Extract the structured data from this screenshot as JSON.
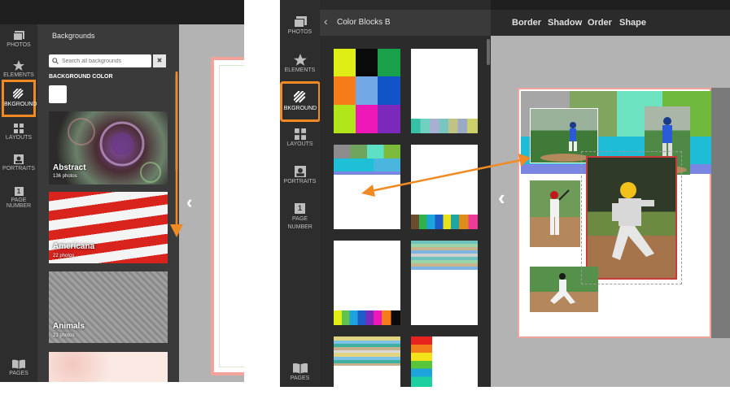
{
  "left": {
    "nav": [
      {
        "key": "photos",
        "label": "PHOTOS",
        "icon": "photos-icon"
      },
      {
        "key": "elements",
        "label": "ELEMENTS",
        "icon": "star-icon"
      },
      {
        "key": "bkground",
        "label": "BKGROUND",
        "icon": "background-stripes-icon"
      },
      {
        "key": "layouts",
        "label": "LAYOUTS",
        "icon": "layouts-icon"
      },
      {
        "key": "portraits",
        "label": "PORTRAITS",
        "icon": "portrait-icon"
      },
      {
        "key": "page_number",
        "label": "PAGE NUMBER",
        "icon": "page-number-icon",
        "glyph": "1"
      },
      {
        "key": "pages",
        "label": "PAGES",
        "icon": "book-icon"
      }
    ],
    "panel_title": "Backgrounds",
    "search_placeholder": "Search all backgrounds",
    "clear_glyph": "✖",
    "bg_color_label": "BACKGROUND COLOR",
    "categories": [
      {
        "title": "Abstract",
        "count": "136 photos"
      },
      {
        "title": "Americana",
        "count": "22 photos"
      },
      {
        "title": "Animals",
        "count": "23 photos"
      }
    ]
  },
  "right": {
    "nav": [
      {
        "key": "photos",
        "label": "PHOTOS",
        "icon": "photos-icon"
      },
      {
        "key": "elements",
        "label": "ELEMENTS",
        "icon": "star-icon"
      },
      {
        "key": "bkground",
        "label": "BKGROUND",
        "icon": "background-stripes-icon"
      },
      {
        "key": "layouts",
        "label": "LAYOUTS",
        "icon": "layouts-icon"
      },
      {
        "key": "portraits",
        "label": "PORTRAITS",
        "icon": "portrait-icon"
      },
      {
        "key": "page_number",
        "label": "PAGE NUMBER",
        "icon": "page-number-icon",
        "glyph": "1"
      },
      {
        "key": "pages",
        "label": "PAGES",
        "icon": "book-icon"
      }
    ],
    "panel_title": "Color Blocks B",
    "back_glyph": "‹",
    "toolbar": [
      "Border",
      "Shadow",
      "Order",
      "Shape"
    ],
    "collapse_glyph": "‹"
  },
  "colors": {
    "highlight": "#f08a24",
    "sidebar": "#2d2d2d",
    "panel": "#3a3a3a",
    "canvas": "#b3b3b3",
    "page_border": "#f2a49a"
  }
}
